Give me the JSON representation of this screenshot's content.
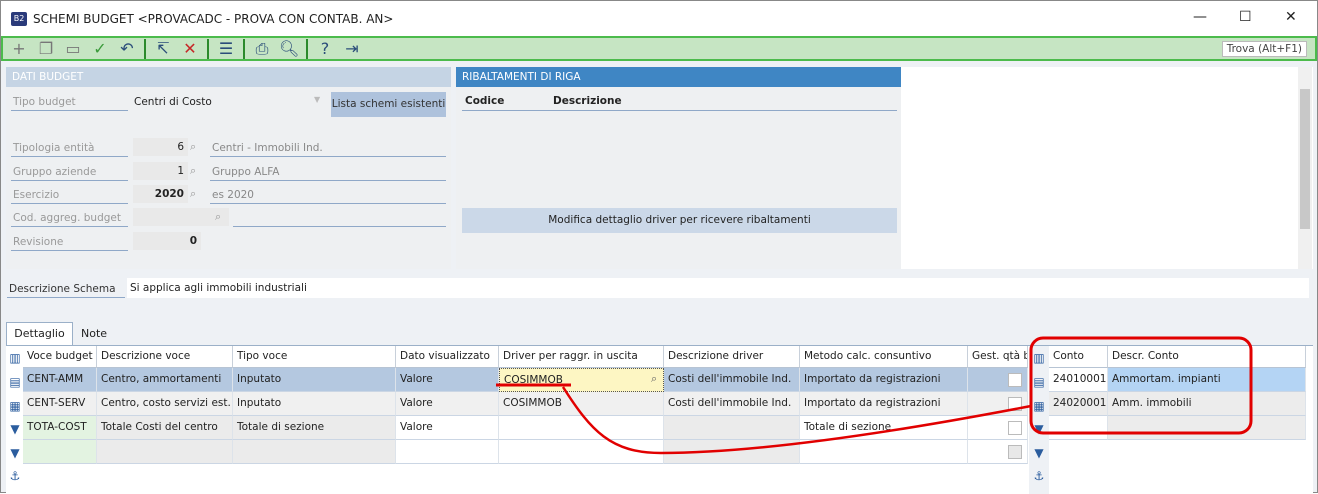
{
  "window": {
    "title": "SCHEMI BUDGET <PROVACADC - PROVA CON CONTAB. AN>",
    "logo": "B2",
    "minimize": "—",
    "maximize": "☐",
    "close": "✕"
  },
  "toolbar": {
    "icons": [
      "plus-icon",
      "duplicate-icon",
      "folder-icon",
      "check-icon",
      "undo-icon",
      "revert-icon",
      "delete-icon",
      "menu-icon",
      "print-icon",
      "preview-icon",
      "help-icon",
      "exit-icon"
    ],
    "find_label": "Trova (Alt+F1)"
  },
  "dati_budget": {
    "title": "DATI BUDGET",
    "tipo_budget_label": "Tipo budget",
    "tipo_budget_value": "Centri di Costo",
    "lista_button": "Lista schemi esistenti",
    "fields": [
      {
        "label": "Tipologia entità",
        "value": "6",
        "desc": "Centri - Immobili Ind."
      },
      {
        "label": "Gruppo aziende",
        "value": "1",
        "desc": "Gruppo ALFA"
      },
      {
        "label": "Esercizio",
        "value": "2020",
        "desc": "es 2020"
      },
      {
        "label": "Cod. aggreg. budget",
        "value": "",
        "desc": ""
      }
    ],
    "revisione_label": "Revisione",
    "revisione_value": "0"
  },
  "ribaltamenti": {
    "title": "RIBALTAMENTI DI RIGA",
    "col_codice": "Codice",
    "col_descrizione": "Descrizione",
    "button": "Modifica dettaglio driver per ricevere ribaltamenti"
  },
  "descrizione_schema": {
    "label": "Descrizione Schema",
    "value": "Si applica agli immobili industriali"
  },
  "tabs": [
    "Dettaglio",
    "Note"
  ],
  "grid": {
    "headers": [
      "Voce budget",
      "Descrizione voce",
      "Tipo voce",
      "Dato visualizzato",
      "Driver per raggr. in uscita",
      "Descrizione driver",
      "Metodo calc. consuntivo",
      "Gest. qtà bu"
    ],
    "rows": [
      [
        "CENT-AMM",
        "Centro, ammortamenti",
        "Inputato",
        "Valore",
        "COSIMMOB",
        "Costi dell'immobile Ind.",
        "Importato da registrazioni"
      ],
      [
        "CENT-SERV",
        "Centro, costo servizi est...",
        "Inputato",
        "Valore",
        "COSIMMOB",
        "Costi dell'immobile Ind.",
        "Importato da registrazioni"
      ],
      [
        "TOTA-COST",
        "Totale Costi del centro",
        "Totale di sezione",
        "Valore",
        "",
        "",
        "Totale di sezione"
      ],
      [
        "",
        "",
        "",
        "",
        "",
        "",
        ""
      ]
    ]
  },
  "conti": {
    "headers": [
      "Conto",
      "Descr. Conto"
    ],
    "rows": [
      [
        "24010001",
        "Ammortam. impianti"
      ],
      [
        "24020001",
        "Amm. immobili"
      ]
    ]
  },
  "colors": {
    "accent": "#3f86c4",
    "toolbar": "#c6e5c3",
    "highlight": "#e10000",
    "selected_row": "#b4c8e0"
  }
}
